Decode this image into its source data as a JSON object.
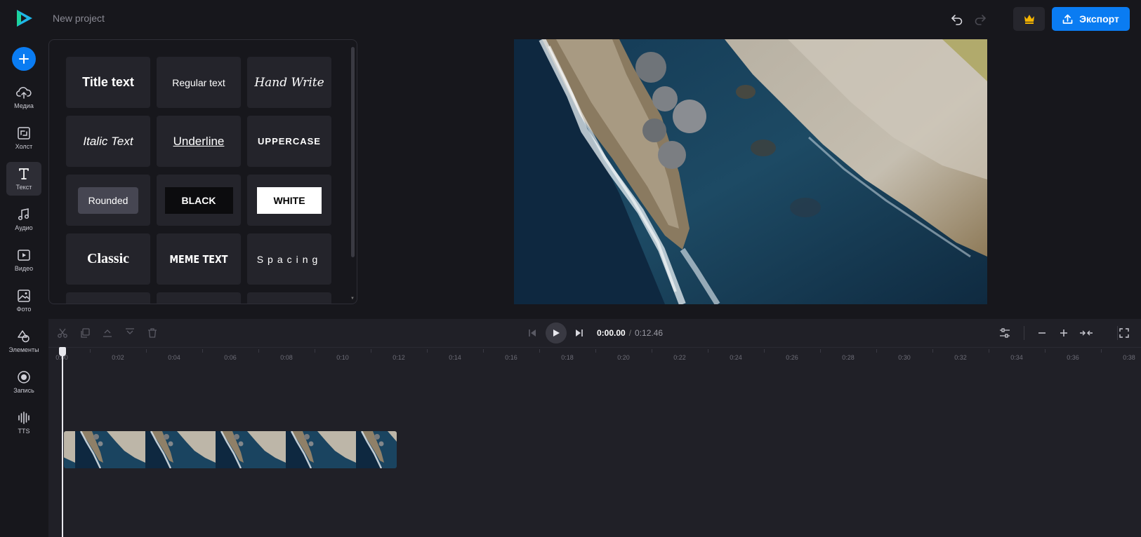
{
  "header": {
    "project_name": "New project",
    "export_label": "Экспорт"
  },
  "sidebar": {
    "items": [
      {
        "label": "Медиа",
        "icon": "upload-cloud-icon"
      },
      {
        "label": "Холст",
        "icon": "canvas-resize-icon"
      },
      {
        "label": "Текст",
        "icon": "text-icon",
        "active": true
      },
      {
        "label": "Аудио",
        "icon": "music-note-icon"
      },
      {
        "label": "Видео",
        "icon": "video-play-icon"
      },
      {
        "label": "Фото",
        "icon": "image-icon"
      },
      {
        "label": "Элементы",
        "icon": "shapes-icon"
      },
      {
        "label": "Запись",
        "icon": "record-icon"
      },
      {
        "label": "TTS",
        "icon": "waveform-icon"
      }
    ]
  },
  "text_styles": [
    {
      "label": "Title text"
    },
    {
      "label": "Regular text"
    },
    {
      "label": "Hand Write"
    },
    {
      "label": "Italic Text"
    },
    {
      "label": "Underline"
    },
    {
      "label": "UPPERCASE"
    },
    {
      "label": "Rounded"
    },
    {
      "label": "BLACK"
    },
    {
      "label": "WHITE"
    },
    {
      "label": "Classic"
    },
    {
      "label": "MEME TEXT"
    },
    {
      "label": "Spacing"
    }
  ],
  "timeline": {
    "current_time": "0:00.00",
    "separator": "/",
    "total_time": "0:12.46",
    "ruler_labels": [
      "0:00",
      "0:02",
      "0:04",
      "0:06",
      "0:08",
      "0:10",
      "0:12",
      "0:14",
      "0:16",
      "0:18",
      "0:20",
      "0:22",
      "0:24",
      "0:26",
      "0:28",
      "0:30",
      "0:32",
      "0:34",
      "0:36",
      "0:38"
    ]
  },
  "colors": {
    "accent": "#0a7cf2",
    "background": "#17171c",
    "timeline_bg": "#202027",
    "premium_crown": "#f5b400"
  }
}
